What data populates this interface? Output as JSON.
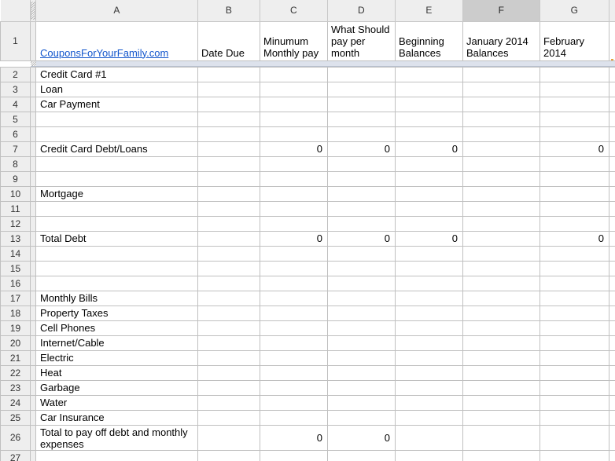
{
  "app": {
    "type": "spreadsheet",
    "selected_column": "F",
    "frozen_rows": 1,
    "frozen_columns": 0
  },
  "colors": {
    "header_bg": "#eeeeee",
    "header_selected_bg": "#cccccc",
    "gridline": "#c0c0c0",
    "link": "#1155cc",
    "freeze_bar": "#dde2ec",
    "marker": "#e8a33d"
  },
  "column_headers": [
    "A",
    "B",
    "C",
    "D",
    "E",
    "F",
    "G"
  ],
  "sheet": {
    "row1": {
      "a_link_text": "CouponsForYourFamily.com",
      "b": "Date Due",
      "c": "Minumum Monthly pay",
      "d": "What Should pay per month",
      "e": "Beginning Balances",
      "f": "January 2014 Balances",
      "g": "February 2014"
    },
    "rows": [
      {
        "n": "2",
        "a": "Credit Card #1",
        "b": "",
        "c": "",
        "d": "",
        "e": "",
        "f": "",
        "g": ""
      },
      {
        "n": "3",
        "a": "Loan",
        "b": "",
        "c": "",
        "d": "",
        "e": "",
        "f": "",
        "g": ""
      },
      {
        "n": "4",
        "a": "Car Payment",
        "b": "",
        "c": "",
        "d": "",
        "e": "",
        "f": "",
        "g": ""
      },
      {
        "n": "5",
        "a": "",
        "b": "",
        "c": "",
        "d": "",
        "e": "",
        "f": "",
        "g": ""
      },
      {
        "n": "6",
        "a": "",
        "b": "",
        "c": "",
        "d": "",
        "e": "",
        "f": "",
        "g": ""
      },
      {
        "n": "7",
        "a": "Credit Card Debt/Loans",
        "b": "",
        "c": "0",
        "d": "0",
        "e": "0",
        "f": "",
        "g": "0"
      },
      {
        "n": "8",
        "a": "",
        "b": "",
        "c": "",
        "d": "",
        "e": "",
        "f": "",
        "g": ""
      },
      {
        "n": "9",
        "a": "",
        "b": "",
        "c": "",
        "d": "",
        "e": "",
        "f": "",
        "g": ""
      },
      {
        "n": "10",
        "a": "Mortgage",
        "b": "",
        "c": "",
        "d": "",
        "e": "",
        "f": "",
        "g": ""
      },
      {
        "n": "11",
        "a": "",
        "b": "",
        "c": "",
        "d": "",
        "e": "",
        "f": "",
        "g": ""
      },
      {
        "n": "12",
        "a": "",
        "b": "",
        "c": "",
        "d": "",
        "e": "",
        "f": "",
        "g": ""
      },
      {
        "n": "13",
        "a": "Total Debt",
        "b": "",
        "c": "0",
        "d": "0",
        "e": "0",
        "f": "",
        "g": "0"
      },
      {
        "n": "14",
        "a": "",
        "b": "",
        "c": "",
        "d": "",
        "e": "",
        "f": "",
        "g": ""
      },
      {
        "n": "15",
        "a": "",
        "b": "",
        "c": "",
        "d": "",
        "e": "",
        "f": "",
        "g": ""
      },
      {
        "n": "16",
        "a": "",
        "b": "",
        "c": "",
        "d": "",
        "e": "",
        "f": "",
        "g": ""
      },
      {
        "n": "17",
        "a": "Monthly Bills",
        "b": "",
        "c": "",
        "d": "",
        "e": "",
        "f": "",
        "g": ""
      },
      {
        "n": "18",
        "a": "Property Taxes",
        "b": "",
        "c": "",
        "d": "",
        "e": "",
        "f": "",
        "g": ""
      },
      {
        "n": "19",
        "a": "Cell Phones",
        "b": "",
        "c": "",
        "d": "",
        "e": "",
        "f": "",
        "g": ""
      },
      {
        "n": "20",
        "a": "Internet/Cable",
        "b": "",
        "c": "",
        "d": "",
        "e": "",
        "f": "",
        "g": ""
      },
      {
        "n": "21",
        "a": "Electric",
        "b": "",
        "c": "",
        "d": "",
        "e": "",
        "f": "",
        "g": ""
      },
      {
        "n": "22",
        "a": "Heat",
        "b": "",
        "c": "",
        "d": "",
        "e": "",
        "f": "",
        "g": ""
      },
      {
        "n": "23",
        "a": "Garbage",
        "b": "",
        "c": "",
        "d": "",
        "e": "",
        "f": "",
        "g": ""
      },
      {
        "n": "24",
        "a": "Water",
        "b": "",
        "c": "",
        "d": "",
        "e": "",
        "f": "",
        "g": ""
      },
      {
        "n": "25",
        "a": "Car Insurance",
        "b": "",
        "c": "",
        "d": "",
        "e": "",
        "f": "",
        "g": ""
      },
      {
        "n": "26",
        "a": "Total to pay off debt and monthly expenses",
        "b": "",
        "c": "0",
        "d": "0",
        "e": "",
        "f": "",
        "g": ""
      },
      {
        "n": "27",
        "a": "",
        "b": "",
        "c": "",
        "d": "",
        "e": "",
        "f": "",
        "g": ""
      }
    ]
  }
}
